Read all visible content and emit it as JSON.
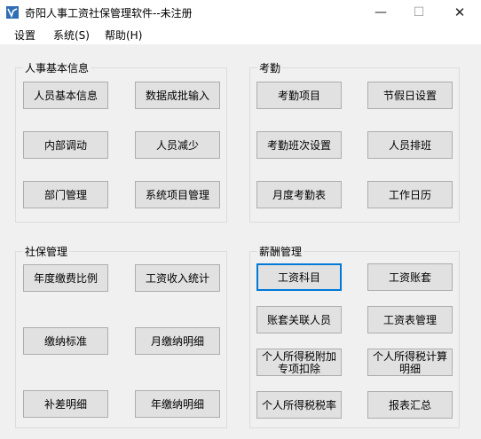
{
  "window": {
    "title": "奇阳人事工资社保管理软件--未注册",
    "minimize_glyph": "—",
    "maximize_glyph": "☐",
    "close_glyph": "✕",
    "icon": "app-logo-icon"
  },
  "menu": [
    "设置",
    "系统(S)",
    "帮助(H)"
  ],
  "groups": {
    "personnel": {
      "title": "人事基本信息",
      "buttons": [
        "人员基本信息",
        "数据成批输入",
        "内部调动",
        "人员减少",
        "部门管理",
        "系统项目管理"
      ]
    },
    "attendance": {
      "title": "考勤",
      "buttons": [
        "考勤项目",
        "节假日设置",
        "考勤班次设置",
        "人员排班",
        "月度考勤表",
        "工作日历"
      ]
    },
    "social_security": {
      "title": "社保管理",
      "buttons": [
        "年度缴费比例",
        "工资收入统计",
        "缴纳标准",
        "月缴纳明细",
        "补差明细",
        "年缴纳明细"
      ]
    },
    "salary": {
      "title": "薪酬管理",
      "buttons": [
        "工资科目",
        "工资账套",
        "账套关联人员",
        "工资表管理",
        "个人所得税附加专项扣除",
        "个人所得税计算明细",
        "个人所得税税率",
        "报表汇总"
      ]
    }
  },
  "colors": {
    "focus": "#0078d7",
    "button_face": "#e1e1e1",
    "background": "#f0f0f0"
  }
}
